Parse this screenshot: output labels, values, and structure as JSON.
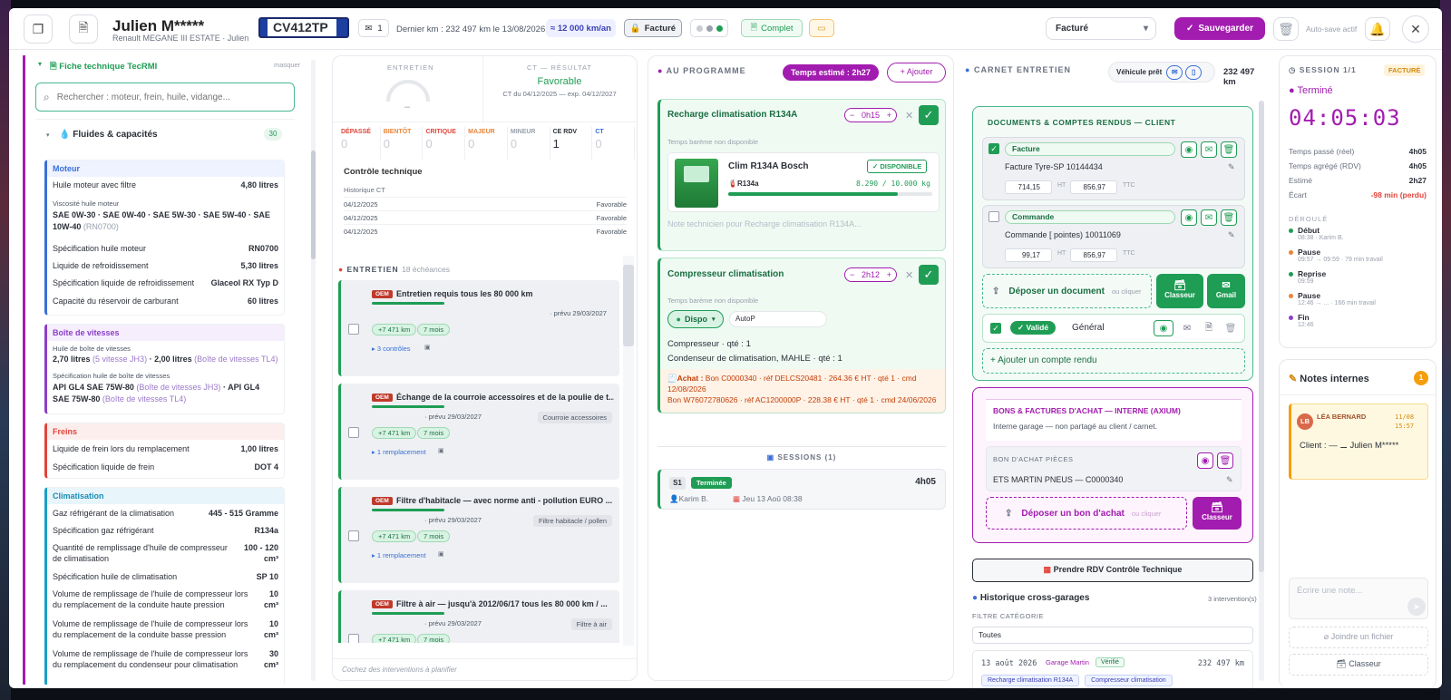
{
  "header": {
    "client_name": "Julien M*****",
    "vehicle": "Renault MEGANE III ESTATE · Julien ...",
    "plate": "CV412TP",
    "msg_count": "1",
    "last_km": "Dernier km : 232 497 km le 13/08/2026",
    "km_per_year": "≈ 12 000 km/an",
    "status_badge": "Facturé",
    "complet_badge": "Complet",
    "status_select": "Facturé",
    "save_button": "Sauvegarder",
    "autosave": "Auto-save actif"
  },
  "tecrmi": {
    "title": "Fiche technique TecRMI",
    "hide": "masquer",
    "search_placeholder": "Rechercher : moteur, frein, huile, vidange...",
    "fluids_title": "Fluides & capacités",
    "fluids_count": "30",
    "moteur": {
      "title": "Moteur",
      "huile": "Huile moteur avec filtre",
      "huile_v": "4,80 litres",
      "visco_label": "Viscosité huile moteur",
      "visco_v": "SAE 0W-30 · SAE 0W-40 · SAE 5W-30 · SAE 5W-40 · SAE 10W-40",
      "visco_ref": "(RN0700)",
      "spec": "Spécification huile moteur",
      "spec_v": "RN0700",
      "refr": "Liquide de refroidissement",
      "refr_v": "5,30 litres",
      "specrefr": "Spécification liquide de refroidissement",
      "specrefr_v": "Glaceol RX Typ D",
      "carb": "Capacité du réservoir de carburant",
      "carb_v": "60 litres"
    },
    "bv": {
      "title": "Boîte de vitesses",
      "huile_label": "Huile de boîte de vitesses",
      "huile_a": "2,70 litres",
      "huile_b": "(5 vitesse JH3)",
      "huile_c": "· 2,00 litres",
      "huile_d": "(Boîte de vitesses TL4)",
      "spec_label": "Spécification huile de boîte de vitesses",
      "spec_a": "API GL4 SAE 75W-80",
      "spec_b": "(Boîte de vitesses JH3)",
      "spec_c": "· API GL4 SAE 75W-80",
      "spec_d": "(Boîte de vitesses TL4)"
    },
    "freins": {
      "title": "Freins",
      "liq": "Liquide de frein lors du remplacement",
      "liq_v": "1,00 litres",
      "spec": "Spécification liquide de frein",
      "spec_v": "DOT 4"
    },
    "clim": {
      "title": "Climatisation",
      "gaz": "Gaz réfrigérant de la climatisation",
      "gaz_v": "445 - 515 Gramme",
      "specgaz": "Spécification gaz réfrigérant",
      "specgaz_v": "R134a",
      "qte": "Quantité de remplissage d'huile de compresseur de climatisation",
      "qte_v": "100 - 120 cm³",
      "spech": "Spécification huile de climatisation",
      "spech_v": "SP 10",
      "vhp": "Volume de remplissage de l'huile de compresseur lors du remplacement de la conduite haute pression",
      "vhp_v": "10 cm³",
      "vbp": "Volume de remplissage de l'huile de compresseur lors du remplacement de la conduite basse pression",
      "vbp_v": "10 cm³",
      "vcond": "Volume de remplissage de l'huile de compresseur lors du remplacement du condenseur pour climatisation",
      "vcond_v": "30 cm³"
    }
  },
  "entretien": {
    "gauge_label": "ENTRETIEN",
    "gauge_val": "–",
    "ct_label": "CT — RÉSULTAT",
    "ct_result": "Favorable",
    "ct_dates": "CT du 04/12/2025 — exp. 04/12/2027",
    "counters": [
      {
        "label": "DÉPASSÉ",
        "value": "0",
        "color": "#e0453a"
      },
      {
        "label": "BIENTÔT",
        "value": "0",
        "color": "#e8843a"
      },
      {
        "label": "CRITIQUE",
        "value": "0",
        "color": "#e0453a"
      },
      {
        "label": "MAJEUR",
        "value": "0",
        "color": "#e8843a"
      },
      {
        "label": "MINEUR",
        "value": "0",
        "color": "#9aa0ad"
      },
      {
        "label": "CE RDV",
        "value": "1",
        "color": "#2b2f38"
      },
      {
        "label": "CT",
        "value": "0",
        "color": "#3b6fd8"
      }
    ],
    "ct_title": "Contrôle technique",
    "ct_hist": "Historique CT",
    "ct_rows": [
      {
        "d": "04/12/2025",
        "r": "Favorable"
      },
      {
        "d": "04/12/2025",
        "r": "Favorable"
      },
      {
        "d": "04/12/2025",
        "r": "Favorable"
      }
    ],
    "list_title": "ENTRETIEN",
    "list_count": "18 échéances",
    "items": [
      {
        "title": "Entretien requis tous les 80 000 km",
        "due": "· prévu 29/03/2027",
        "tag": "",
        "km": "+7 471 km",
        "mois": "7 mois",
        "link": "▸ 3 contrôles"
      },
      {
        "title": "Échange de la courroie accessoires et de la poulie de t...",
        "due": "· prévu 29/03/2027",
        "tag": "Courroie accessoires",
        "km": "+7 471 km",
        "mois": "7 mois",
        "link": "▸ 1 remplacement"
      },
      {
        "title": "Filtre d'habitacle — avec norme anti - pollution EURO ...",
        "due": "· prévu 29/03/2027",
        "tag": "Filtre habitacle / pollen",
        "km": "+7 471 km",
        "mois": "7 mois",
        "link": "▸ 1 remplacement"
      },
      {
        "title": "Filtre à air — jusqu'à 2012/06/17 tous les 80 000 km / ...",
        "due": "· prévu 29/03/2027",
        "tag": "Filtre à air",
        "km": "+7 471 km",
        "mois": "7 mois",
        "link": ""
      }
    ],
    "oem": "OEM",
    "footer": "Cochez des interventions à planifier"
  },
  "programme": {
    "title": "AU PROGRAMME",
    "time_est": "Temps estimé : 2h27",
    "add": "+ Ajouter",
    "job1": {
      "title": "Recharge climatisation R134A",
      "dur": "0h15",
      "bareme": "Temps barème non disponible",
      "product": "Clim R134A Bosch",
      "dispo": "✓ DISPONIBLE",
      "gas": "R134a",
      "gas_val": "8.290 / 10.000 kg",
      "gas_fill": 0.829,
      "note": "Note technicien pour Recharge climatisation R134A..."
    },
    "job2": {
      "title": "Compresseur climatisation",
      "dur": "2h12",
      "bareme": "Temps barème non disponible",
      "dispo": "Dispo",
      "supplier": "AutoP",
      "line1": "Compresseur · qté : 1",
      "line2": "Condenseur de climatisation, MAHLE · qté : 1",
      "achat_label": "Achat :",
      "achat1": "Bon C0000340 · réf DELCS20481 · 264.36 € HT · qté 1 · cmd 12/08/2026",
      "achat2": "Bon W76072780626 · réf AC1200000P · 228.38 € HT · qté 1 · cmd 24/06/2026"
    },
    "sessions_title": "SESSIONS (1)",
    "session": {
      "id": "S1",
      "status": "Terminée",
      "dur": "4h05",
      "tech": "Karim B.",
      "date": "Jeu 13 Aoû 08:38"
    }
  },
  "carnet": {
    "title": "CARNET ENTRETIEN",
    "vehicule_pret": "Véhicule prêt",
    "km": "232 497 km",
    "docs_title": "DOCUMENTS & COMPTES RENDUS — CLIENT",
    "facture": {
      "label": "Facture",
      "name": "Facture Tyre-SP 10144434",
      "ht": "714,15",
      "ttc": "856,97"
    },
    "commande": {
      "label": "Commande",
      "name": "Commande [ pointes) 10011069",
      "ht": "99,17",
      "ttc": "856,97"
    },
    "ht": "HT",
    "ttc": "TTC",
    "drop": "Déposer un document",
    "ou": "ou cliquer",
    "classeur": "Classeur",
    "gmail": "Gmail",
    "valide": "Validé",
    "general": "Général",
    "add_cr": "+ Ajouter un compte rendu",
    "bons_title": "BONS & FACTURES D'ACHAT — INTERNE (AXIUM)",
    "bons_sub": "Interne garage — non partagé au client / carnet.",
    "bon_label": "BON D'ACHAT PIÈCES",
    "bon_name": "ETS MARTIN PNEUS — C0000340",
    "drop_bon": "Déposer un bon d'achat",
    "rdv_ct": "Prendre RDV Contrôle Technique",
    "histo": "Historique cross-garages",
    "histo_count": "3 intervention(s)",
    "filtre": "FILTRE CATÉGORIE",
    "filtre_val": "Toutes",
    "hist_item": {
      "date": "13 août 2026",
      "garage": "Garage Martin",
      "verif": "Vérifié",
      "km": "232 497 km",
      "tags": [
        "Recharge climatisation R134A",
        "Compresseur climatisation"
      ]
    }
  },
  "session": {
    "title": "SESSION 1/1",
    "badge": "FACTURÉ",
    "status": "Terminé",
    "timer": "04:05:03",
    "rows": [
      {
        "l": "Temps passé (réel)",
        "v": "4h05",
        "c": "#2b2f38"
      },
      {
        "l": "Temps agrégé (RDV)",
        "v": "4h05",
        "c": "#2b2f38"
      },
      {
        "l": "Estimé",
        "v": "2h27",
        "c": "#2b2f38"
      },
      {
        "l": "Écart",
        "v": "-98 min (perdu)",
        "c": "#e0453a"
      }
    ],
    "deroule": "DÉROULÉ",
    "steps": [
      {
        "t": "Début",
        "s": "08:38 · Karim B.",
        "c": "#1f9d55"
      },
      {
        "t": "Pause",
        "s": "09:57 → 09:59 · 79 min travail",
        "c": "#e8843a"
      },
      {
        "t": "Reprise",
        "s": "09:59",
        "c": "#1f9d55"
      },
      {
        "t": "Pause",
        "s": "12:46 → ... · 166 min travail",
        "c": "#e8843a"
      },
      {
        "t": "Fin",
        "s": "12:46",
        "c": "#8b3fc8"
      }
    ]
  },
  "notes": {
    "title": "Notes internes",
    "count": "1",
    "initials": "LB",
    "author": "LÉA BERNARD",
    "date": "11/08 15:57",
    "text": "Client : — ⚊ Julien M*****",
    "placeholder": "Écrire une note...",
    "attach": "Joindre un fichier",
    "classeur": "Classeur"
  }
}
